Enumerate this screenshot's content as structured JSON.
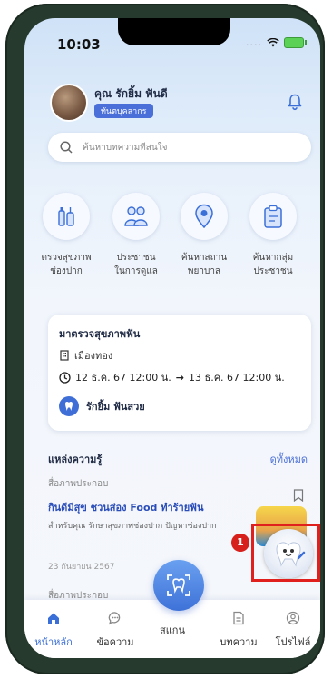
{
  "status_bar": {
    "time": "10:03",
    "signal": "...."
  },
  "user": {
    "name": "คุณ รักยิ้ม ฟันดี",
    "role": "ทันตบุคลากร"
  },
  "search": {
    "placeholder": "ค้นหาบทความที่สนใจ"
  },
  "quick_actions": [
    {
      "line1": "ตรวจสุขภาพ",
      "line2": "ช่องปาก",
      "icon": "oral-care-icon"
    },
    {
      "line1": "ประชาชน",
      "line2": "ในการดูแล",
      "icon": "family-icon"
    },
    {
      "line1": "ค้นหาสถาน",
      "line2": "พยาบาล",
      "icon": "location-pin-icon"
    },
    {
      "line1": "ค้นหากลุ่ม",
      "line2": "ประชาชน",
      "icon": "clipboard-icon"
    }
  ],
  "appointment": {
    "title": "มาตรวจสุขภาพฟัน",
    "location": "เมืองทอง",
    "start": "12 ธ.ค. 67 12:00 น.",
    "arrow": "→",
    "end": "13 ธ.ค. 67 12:00 น.",
    "dentist": "รักยิ้ม ฟันสวย"
  },
  "knowledge": {
    "title": "แหล่งความรู้",
    "see_all": "ดูทั้งหมด",
    "article": {
      "category": "สื่อภาพประกอบ",
      "title": "กินดีมีสุข ชวนส่อง Food ทำร้ายฟัน",
      "desc": "สำหรับคุณ รักษาสุขภาพช่องปาก ปัญหาช่องปาก",
      "date": "23 กันยายน 2567"
    },
    "next_category": "สื่อภาพประกอบ"
  },
  "annotation": {
    "number": "1"
  },
  "tabs": [
    {
      "label": "หน้าหลัก",
      "icon": "home-icon",
      "active": true
    },
    {
      "label": "ข้อความ",
      "icon": "chat-icon",
      "active": false
    },
    {
      "label": "สแกน",
      "icon": "scan-tooth-icon",
      "active": false
    },
    {
      "label": "บทความ",
      "icon": "document-icon",
      "active": false
    },
    {
      "label": "โปรไฟล์",
      "icon": "profile-icon",
      "active": false
    }
  ],
  "colors": {
    "accent": "#3b6fd8",
    "badge": "#4a6fd8",
    "highlight": "#e0201c"
  }
}
